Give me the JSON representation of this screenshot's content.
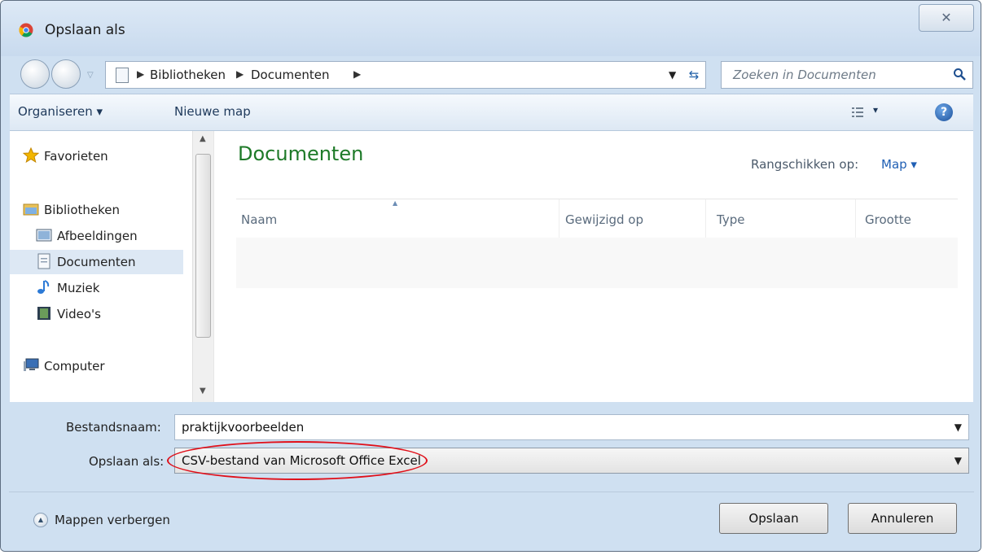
{
  "window": {
    "title": "Opslaan als",
    "close_glyph": "✕"
  },
  "address": {
    "crumbs": [
      "Bibliotheken",
      "Documenten"
    ],
    "search_placeholder": "Zoeken in Documenten"
  },
  "toolbar": {
    "organize": "Organiseren ▾",
    "new_folder": "Nieuwe map",
    "view_glyph": "▾",
    "help_glyph": "?"
  },
  "nav": {
    "favorites": "Favorieten",
    "libraries": "Bibliotheken",
    "pictures": "Afbeeldingen",
    "documents": "Documenten",
    "music": "Muziek",
    "videos": "Video's",
    "computer": "Computer"
  },
  "filepane": {
    "title": "Documenten",
    "arrange_label": "Rangschikken op:",
    "arrange_value": "Map ▾",
    "columns": [
      "Naam",
      "Gewijzigd op",
      "Type",
      "Grootte"
    ]
  },
  "form": {
    "filename_label": "Bestandsnaam:",
    "filename_value": "praktijkvoorbeelden",
    "filetype_label": "Opslaan als:",
    "filetype_value": "CSV-bestand van Microsoft Office Excel"
  },
  "footer": {
    "hide_folders": "Mappen verbergen",
    "save": "Opslaan",
    "cancel": "Annuleren"
  },
  "colors": {
    "highlight": "#e0101a",
    "title_green": "#1e7a28",
    "link_blue": "#1f5fb4"
  }
}
